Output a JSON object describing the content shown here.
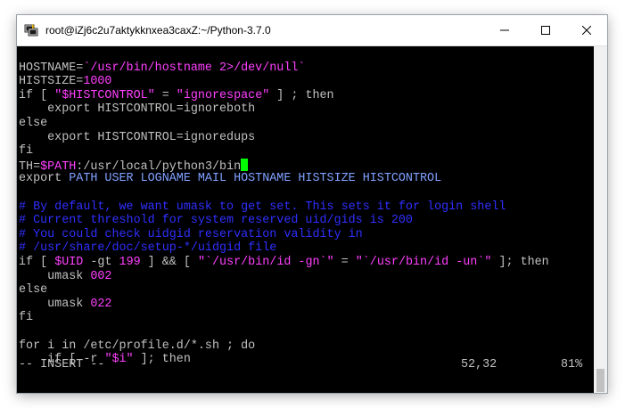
{
  "window": {
    "title": "root@iZj6c2u7aktykknxea3caxZ:~/Python-3.7.0",
    "icon": "putty-icon"
  },
  "editor": {
    "lines": [
      [],
      [
        {
          "t": "HOSTNAME=",
          "c": "def"
        },
        {
          "t": "`/usr/bin/hostname 2>/dev/null`",
          "c": "str"
        }
      ],
      [
        {
          "t": "HISTSIZE=",
          "c": "def"
        },
        {
          "t": "1000",
          "c": "num"
        }
      ],
      [
        {
          "t": "if [ ",
          "c": "def"
        },
        {
          "t": "\"$HISTCONTROL\"",
          "c": "str"
        },
        {
          "t": " = ",
          "c": "def"
        },
        {
          "t": "\"ignorespace\"",
          "c": "str"
        },
        {
          "t": " ] ; then",
          "c": "def"
        }
      ],
      [
        {
          "t": "    export HISTCONTROL=ignoreboth",
          "c": "def"
        }
      ],
      [
        {
          "t": "else",
          "c": "def"
        }
      ],
      [
        {
          "t": "    export HISTCONTROL=ignoredups",
          "c": "def"
        }
      ],
      [
        {
          "t": "fi",
          "c": "def"
        }
      ],
      [
        {
          "t": "TH=",
          "c": "def"
        },
        {
          "t": "$PATH",
          "c": "var"
        },
        {
          "t": ":/usr/local/python3/bin",
          "c": "def"
        }
      ],
      [
        {
          "t": "export ",
          "c": "def"
        },
        {
          "t": "PATH USER LOGNAME MAIL HOSTNAME HISTSIZE HISTCONTROL",
          "c": "key"
        }
      ],
      [],
      [
        {
          "t": "# By default, we want umask to get set. This sets it for login shell",
          "c": "cmt"
        }
      ],
      [
        {
          "t": "# Current threshold for system reserved uid/gids is 200",
          "c": "cmt"
        }
      ],
      [
        {
          "t": "# You could check uidgid reservation validity in",
          "c": "cmt"
        }
      ],
      [
        {
          "t": "# /usr/share/doc/setup-*/uidgid file",
          "c": "cmt"
        }
      ],
      [
        {
          "t": "if [ ",
          "c": "def"
        },
        {
          "t": "$UID",
          "c": "var"
        },
        {
          "t": " -gt ",
          "c": "def"
        },
        {
          "t": "199",
          "c": "num"
        },
        {
          "t": " ] && [ ",
          "c": "def"
        },
        {
          "t": "\"`/usr/bin/id -gn`\"",
          "c": "str"
        },
        {
          "t": " = ",
          "c": "def"
        },
        {
          "t": "\"`/usr/bin/id -un`\"",
          "c": "str"
        },
        {
          "t": " ]; then",
          "c": "def"
        }
      ],
      [
        {
          "t": "    umask ",
          "c": "def"
        },
        {
          "t": "002",
          "c": "num"
        }
      ],
      [
        {
          "t": "else",
          "c": "def"
        }
      ],
      [
        {
          "t": "    umask ",
          "c": "def"
        },
        {
          "t": "022",
          "c": "num"
        }
      ],
      [
        {
          "t": "fi",
          "c": "def"
        }
      ],
      [],
      [
        {
          "t": "for i in /etc/profile.d/*.sh ; do",
          "c": "def"
        }
      ],
      [
        {
          "t": "    if [ -r ",
          "c": "def"
        },
        {
          "t": "\"$i\"",
          "c": "str"
        },
        {
          "t": " ]; then",
          "c": "def"
        }
      ]
    ],
    "cursor_line": 8
  },
  "status": {
    "mode": "-- INSERT --",
    "position": "52,32",
    "percent": "81%"
  },
  "colors": {
    "background": "#000000",
    "text": "#c0c0c0",
    "string": "#ff40ff",
    "comment": "#2f2fff",
    "keyword": "#80a0ff",
    "cursor": "#00ff00"
  }
}
